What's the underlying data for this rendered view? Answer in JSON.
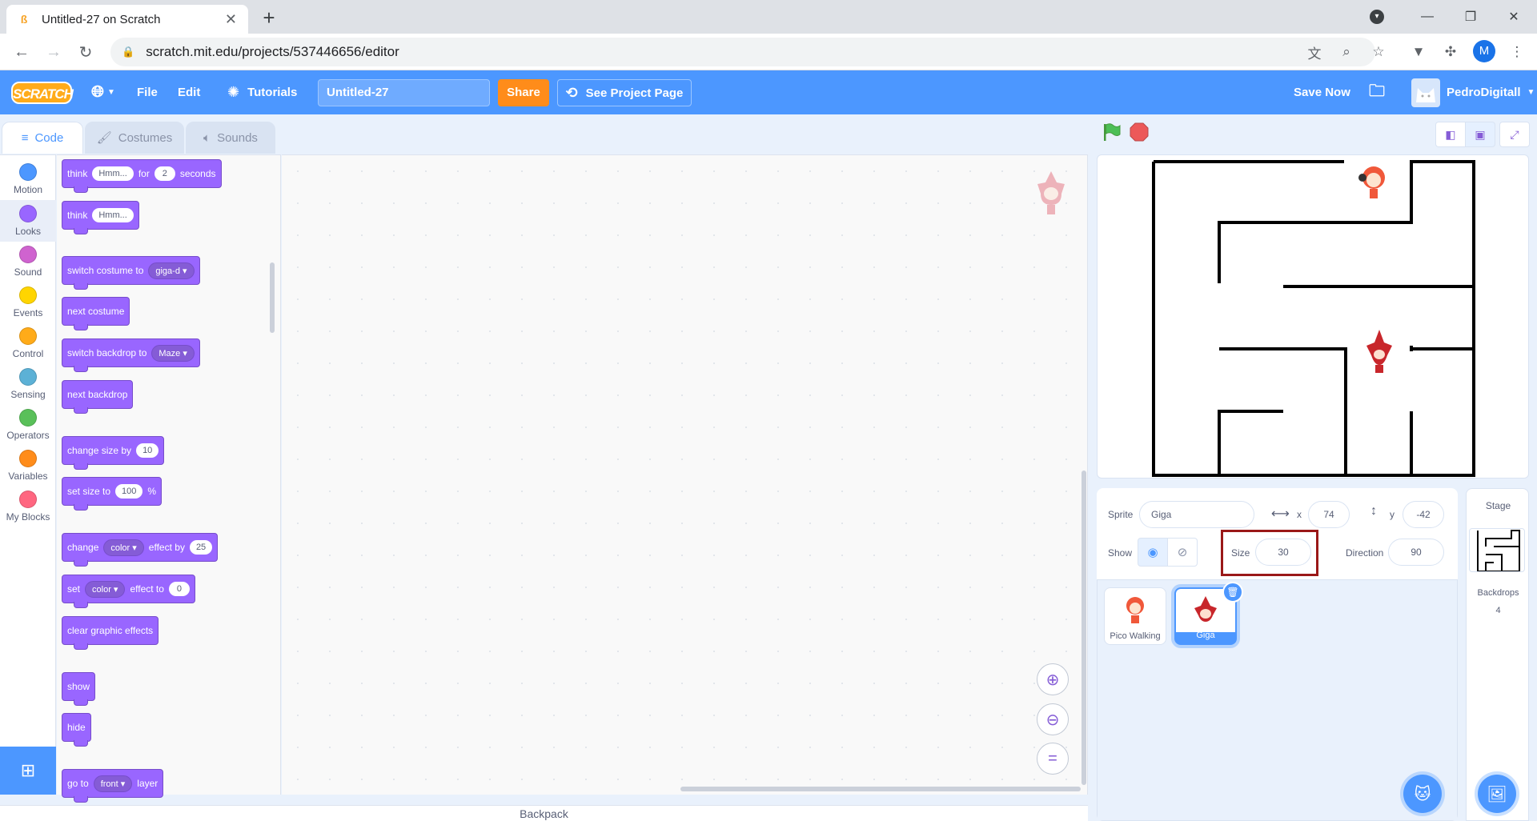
{
  "browser": {
    "tab_title": "Untitled-27 on Scratch",
    "url": "scratch.mit.edu/projects/537446656/editor",
    "profile_initial": "M"
  },
  "menubar": {
    "logo": "SCRATCH",
    "file": "File",
    "edit": "Edit",
    "tutorials": "Tutorials",
    "project_title": "Untitled-27",
    "share": "Share",
    "see_project_page": "See Project Page",
    "save_now": "Save Now",
    "username": "PedroDigitall"
  },
  "editor_tabs": {
    "code": "Code",
    "costumes": "Costumes",
    "sounds": "Sounds"
  },
  "categories": [
    {
      "label": "Motion",
      "color": "#4c97ff"
    },
    {
      "label": "Looks",
      "color": "#9966ff"
    },
    {
      "label": "Sound",
      "color": "#cf63cf"
    },
    {
      "label": "Events",
      "color": "#ffd500"
    },
    {
      "label": "Control",
      "color": "#ffab19"
    },
    {
      "label": "Sensing",
      "color": "#5cb1d6"
    },
    {
      "label": "Operators",
      "color": "#59c059"
    },
    {
      "label": "Variables",
      "color": "#ff8c1a"
    },
    {
      "label": "My Blocks",
      "color": "#ff6680"
    }
  ],
  "blocks": {
    "think_for": {
      "a": "think",
      "msg": "Hmm...",
      "b": "for",
      "secs": "2",
      "c": "seconds"
    },
    "think": {
      "a": "think",
      "msg": "Hmm..."
    },
    "switch_costume": {
      "a": "switch costume to",
      "val": "giga-d"
    },
    "next_costume": "next costume",
    "switch_backdrop": {
      "a": "switch backdrop to",
      "val": "Maze"
    },
    "next_backdrop": "next backdrop",
    "change_size": {
      "a": "change size by",
      "val": "10"
    },
    "set_size": {
      "a": "set size to",
      "val": "100",
      "b": "%"
    },
    "change_effect": {
      "a": "change",
      "effect": "color",
      "b": "effect by",
      "val": "25"
    },
    "set_effect": {
      "a": "set",
      "effect": "color",
      "b": "effect to",
      "val": "0"
    },
    "clear_effects": "clear graphic effects",
    "show": "show",
    "hide": "hide",
    "go_to_layer": {
      "a": "go to",
      "val": "front",
      "b": "layer"
    }
  },
  "backpack": "Backpack",
  "sprite_info": {
    "sprite_label": "Sprite",
    "sprite_name": "Giga",
    "x_label": "x",
    "x": "74",
    "y_label": "y",
    "y": "-42",
    "show_label": "Show",
    "size_label": "Size",
    "size": "30",
    "direction_label": "Direction",
    "direction": "90"
  },
  "sprites": [
    {
      "name": "Pico Walking",
      "selected": false
    },
    {
      "name": "Giga",
      "selected": true
    }
  ],
  "stage_pane": {
    "title": "Stage",
    "backdrops_label": "Backdrops",
    "backdrops_count": "4"
  }
}
